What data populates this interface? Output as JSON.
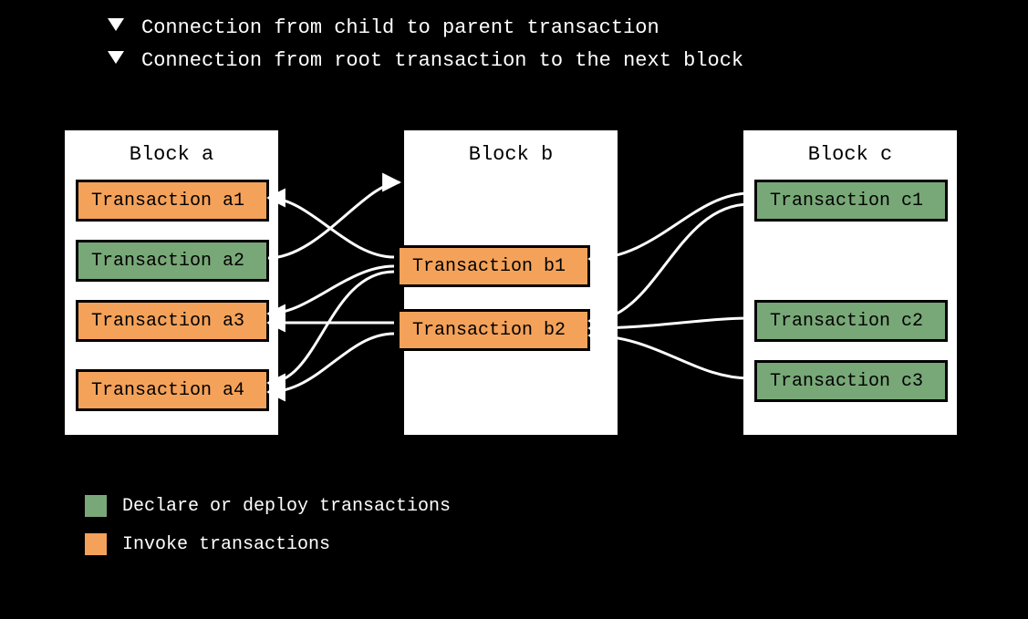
{
  "caption_parent": "Connection from child to parent transaction",
  "caption_root": "Connection from root transaction to the next block",
  "blocks": {
    "a": {
      "title": "Block a"
    },
    "b": {
      "title": "Block b"
    },
    "c": {
      "title": "Block c"
    }
  },
  "transactions": {
    "a1": {
      "label": "Transaction a1",
      "kind": "invoke"
    },
    "a2": {
      "label": "Transaction a2",
      "kind": "declare_deploy"
    },
    "a3": {
      "label": "Transaction a3",
      "kind": "invoke"
    },
    "a4": {
      "label": "Transaction a4",
      "kind": "invoke"
    },
    "b1": {
      "label": "Transaction b1",
      "kind": "invoke"
    },
    "b2": {
      "label": "Transaction b2",
      "kind": "invoke"
    },
    "c1": {
      "label": "Transaction c1",
      "kind": "declare_deploy"
    },
    "c2": {
      "label": "Transaction c2",
      "kind": "declare_deploy"
    },
    "c3": {
      "label": "Transaction c3",
      "kind": "declare_deploy"
    }
  },
  "legend": {
    "declare_deploy": {
      "label": "Declare or deploy transactions",
      "color": "#78a877"
    },
    "invoke": {
      "label": "Invoke transactions",
      "color": "#f4a25a"
    }
  },
  "colors": {
    "declare_deploy": "#78a877",
    "invoke": "#f4a25a",
    "panel": "#ffffff",
    "stroke": "#000000",
    "bg": "#000000"
  },
  "edges_child_to_parent": [
    [
      "b1",
      "a1"
    ],
    [
      "b1",
      "a3"
    ],
    [
      "b1",
      "a4"
    ],
    [
      "b2",
      "a3"
    ],
    [
      "b2",
      "a4"
    ],
    [
      "c1",
      "b1"
    ],
    [
      "c1",
      "b2"
    ],
    [
      "c2",
      "b2"
    ],
    [
      "c3",
      "b2"
    ]
  ],
  "edges_root_to_next_block": [
    [
      "a2",
      "b"
    ]
  ]
}
